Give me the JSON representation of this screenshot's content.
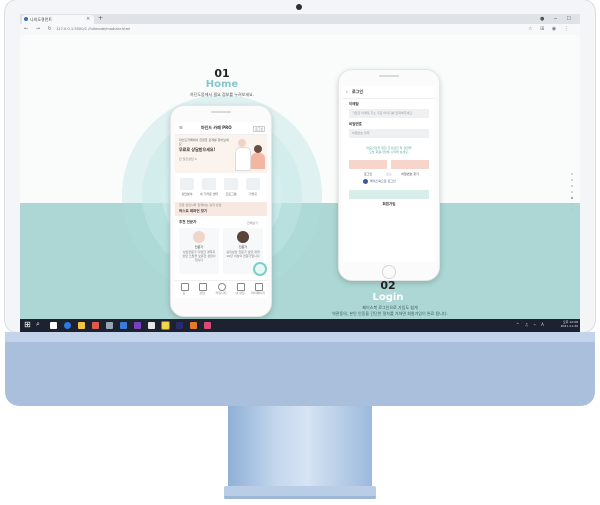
{
  "browser": {
    "tab_title": "나의도큐먼트",
    "tab_close": "×",
    "new_tab": "+",
    "nav_icons": "←  →  ↻",
    "url": "127.0.0.1:5500/1 /fullmode/modular.html",
    "window_controls": "●  ─  ☐  ✕",
    "addr_icons": "☆  ⊞  ◉  ⋮"
  },
  "section_home": {
    "number": "01",
    "title": "Home",
    "description": "하단도움에서 필요 정보를 누려보세요."
  },
  "section_login": {
    "number": "02",
    "title": "Login",
    "description_line1": "페이스북 로그인으로 가입도 쉽게",
    "description_line2": "약관동의, 본인 인증을 간단한 절차를 거쳐면 회원가입이 완료 됩니다."
  },
  "home_phone": {
    "app_title": "마인드 카페 PRO",
    "menu_icon": "☰",
    "badge": "로그인",
    "banner_caption": "마인드카페에서 진정한 관계를 찾아보세요",
    "banner_headline": "무료로 상담받으세요!",
    "banner_sub": "전 월간상담 4",
    "categories": [
      "상담분야",
      "내 가까운 센터",
      "프로그램",
      "가볼곳"
    ],
    "promo_caption": "전문 상담사와 함께하는 심리 상담",
    "promo_title": "박스로 레퍼런 찾기",
    "experts_title": "추천 전문가",
    "experts_more": "전체보기",
    "experts": [
      {
        "name": "전문가",
        "desc": "상담전문가 다양한 경력과 상담 스킬을 보유한 상담사입니다"
      },
      {
        "name": "전문가",
        "desc": "심리상담 전문가 상담 경력 10년 이상의 전문가입니다"
      }
    ],
    "bottom_nav": [
      "홈",
      "상담",
      "커뮤니티",
      "내 상담",
      "마이페이지"
    ]
  },
  "login_phone": {
    "back_arrow": "‹",
    "header_title": "로그인",
    "email_label": "이메일",
    "email_placeholder": "가입한 이메일 주소 혹은 아이디를 입력해주세요",
    "password_label": "비밀번호",
    "password_placeholder": "비밀번호 입력",
    "notice_line1": "마음건강을 위한 건강검진 및 상담을",
    "notice_line2": "오늘 회원가입해 시작해 보세요.",
    "login_button": "로그인",
    "find_password_button": "비밀번호 찾기",
    "or_text": "또는",
    "facebook_login": "페이스북으로 로그인",
    "signup_button": "회원가입"
  },
  "taskbar": {
    "start_icon": "⊞",
    "search_icon": "⌕",
    "tray_icons": "^ ♫ ⌁ A",
    "time": "오후 12:08",
    "date": "2021-11-30"
  },
  "colors": {
    "accent_teal": "#86c7cc",
    "band_teal": "#acd7d4",
    "imac_blue": "#a9bfdc",
    "login_pink": "#f7d5cb"
  }
}
